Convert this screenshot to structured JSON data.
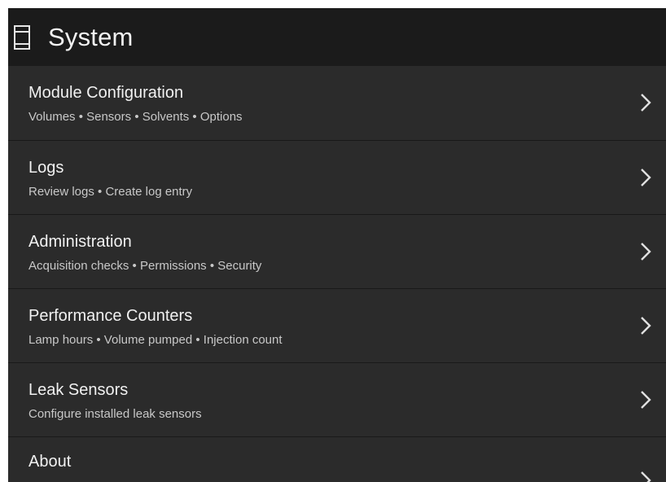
{
  "header": {
    "icon": "tablet-icon",
    "title": "System"
  },
  "menu": {
    "items": [
      {
        "title": "Module Configuration",
        "subtitle": "Volumes • Sensors • Solvents • Options"
      },
      {
        "title": "Logs",
        "subtitle": "Review logs • Create log entry"
      },
      {
        "title": "Administration",
        "subtitle": "Acquisition checks • Permissions • Security"
      },
      {
        "title": "Performance Counters",
        "subtitle": "Lamp hours • Volume pumped • Injection count"
      },
      {
        "title": "Leak Sensors",
        "subtitle": "Configure installed leak sensors"
      },
      {
        "title": "About",
        "subtitle": ""
      }
    ]
  },
  "colors": {
    "header_bg": "#1b1b1b",
    "item_bg": "#2b2b2b",
    "text_primary": "#f1f1f1",
    "text_secondary": "#c8c8c8",
    "divider": "#191919"
  }
}
